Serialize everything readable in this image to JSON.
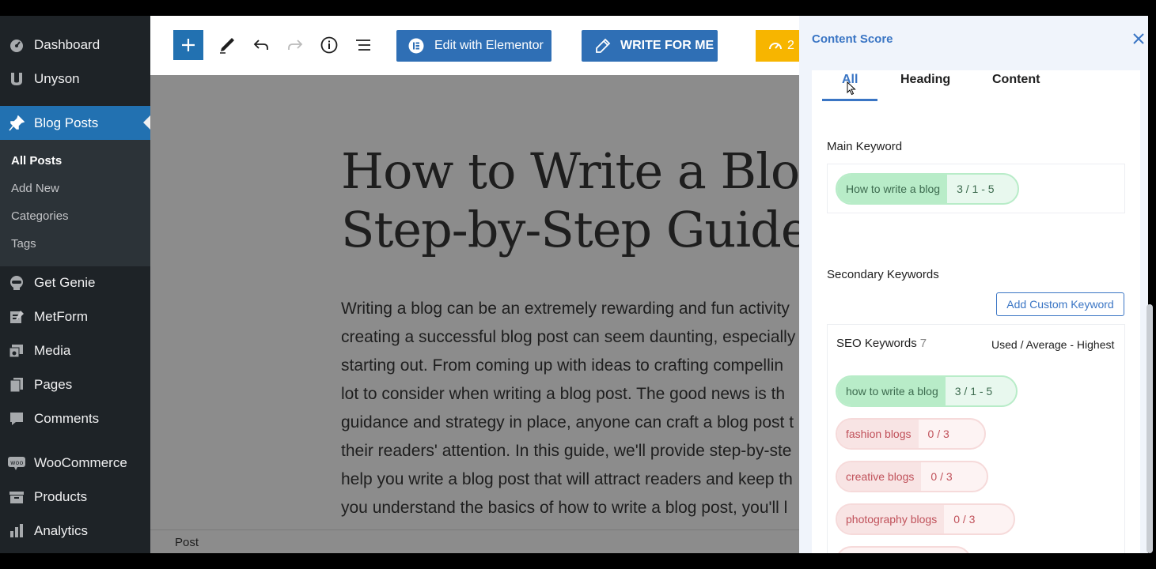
{
  "sidebar": {
    "top_items": [
      {
        "label": "Dashboard",
        "icon": "dashboard-icon"
      },
      {
        "label": "Unyson",
        "icon": "unyson-icon"
      }
    ],
    "active_item": {
      "label": "Blog Posts",
      "icon": "pin-icon"
    },
    "submenu": [
      {
        "label": "All Posts",
        "current": true
      },
      {
        "label": "Add New"
      },
      {
        "label": "Categories"
      },
      {
        "label": "Tags"
      }
    ],
    "bottom_items": [
      {
        "label": "Get Genie",
        "icon": "genie-icon"
      },
      {
        "label": "MetForm",
        "icon": "metform-icon"
      },
      {
        "label": "Media",
        "icon": "media-icon"
      },
      {
        "label": "Pages",
        "icon": "pages-icon"
      },
      {
        "label": "Comments",
        "icon": "comments-icon"
      },
      {
        "label": "WooCommerce",
        "icon": "woocommerce-icon"
      },
      {
        "label": "Products",
        "icon": "products-icon"
      },
      {
        "label": "Analytics",
        "icon": "analytics-icon"
      }
    ]
  },
  "toolbar": {
    "elementor_label": "Edit with Elementor",
    "write_label": "WRITE FOR ME",
    "yellow_label": "2"
  },
  "post": {
    "title_line1": "How to Write a Blog Po",
    "title_line2": "Step-by-Step Guide",
    "body_lines": [
      "Writing a blog can be an extremely rewarding and fun activity",
      "creating a successful blog post can seem daunting, especially",
      "starting out. From coming up with ideas to crafting compellin",
      "lot to consider when writing a blog post. The good news is th",
      "guidance and strategy in place, anyone can craft a blog post t",
      "their readers' attention. In this guide, we'll provide step-by-ste",
      "help you write a blog post that will attract readers and keep th",
      "you understand the basics of how to write a blog post, you'll l"
    ],
    "status_label": "Post"
  },
  "panel": {
    "title": "Content Score",
    "tabs": [
      {
        "label": "All",
        "active": true
      },
      {
        "label": "Heading"
      },
      {
        "label": "Content"
      }
    ],
    "main_keyword_label": "Main Keyword",
    "main_keyword": {
      "label": "How to write a blog",
      "count": "3 / 1 - 5"
    },
    "secondary_label": "Secondary Keywords",
    "add_custom_label": "Add Custom Keyword",
    "seo_label": "SEO Keywords",
    "seo_count": "7",
    "seo_legend": "Used / Average - Highest",
    "seo_keywords": [
      {
        "label": "how to write a blog",
        "count": "3 / 1 - 5",
        "status": "green"
      },
      {
        "label": "fashion blogs",
        "count": "0 / 3",
        "status": "red"
      },
      {
        "label": "creative blogs",
        "count": "0 / 3",
        "status": "red"
      },
      {
        "label": "photography blogs",
        "count": "0 / 3",
        "status": "red"
      }
    ]
  },
  "colors": {
    "wp_blue": "#2271b1",
    "accent_blue": "#3a75c4",
    "genie_yellow": "#f7b500",
    "green_pill": "#b8ecc8",
    "red_pill": "#f8e4e4"
  }
}
